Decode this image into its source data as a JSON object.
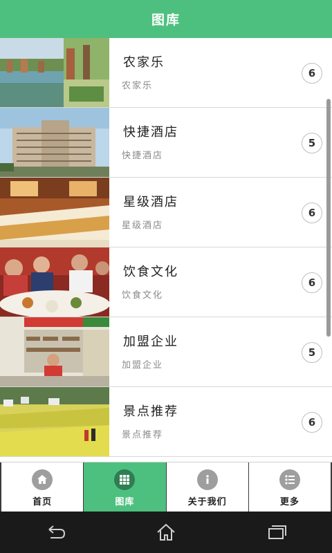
{
  "header": {
    "title": "图库"
  },
  "list": [
    {
      "title": "农家乐",
      "subtitle": "农家乐",
      "count": "6",
      "image": "farmhouse-photo"
    },
    {
      "title": "快捷酒店",
      "subtitle": "快捷酒店",
      "count": "5",
      "image": "hotel-building-photo"
    },
    {
      "title": "星级酒店",
      "subtitle": "星级酒店",
      "count": "6",
      "image": "hotel-room-photo"
    },
    {
      "title": "饮食文化",
      "subtitle": "饮食文化",
      "count": "6",
      "image": "dining-photo"
    },
    {
      "title": "加盟企业",
      "subtitle": "加盟企业",
      "count": "5",
      "image": "shop-photo"
    },
    {
      "title": "景点推荐",
      "subtitle": "景点推荐",
      "count": "6",
      "image": "flower-field-photo"
    }
  ],
  "tabs": [
    {
      "label": "首页",
      "icon": "home-icon",
      "active": false
    },
    {
      "label": "图库",
      "icon": "grid-icon",
      "active": true
    },
    {
      "label": "关于我们",
      "icon": "info-icon",
      "active": false
    },
    {
      "label": "更多",
      "icon": "list-icon",
      "active": false
    }
  ],
  "system_nav": {
    "buttons": [
      "back-icon",
      "home-icon",
      "recent-apps-icon"
    ]
  },
  "colors": {
    "accent": "#4dc07f",
    "accent_dark": "#2f7e52",
    "nav_bg": "#1a1a1a"
  }
}
